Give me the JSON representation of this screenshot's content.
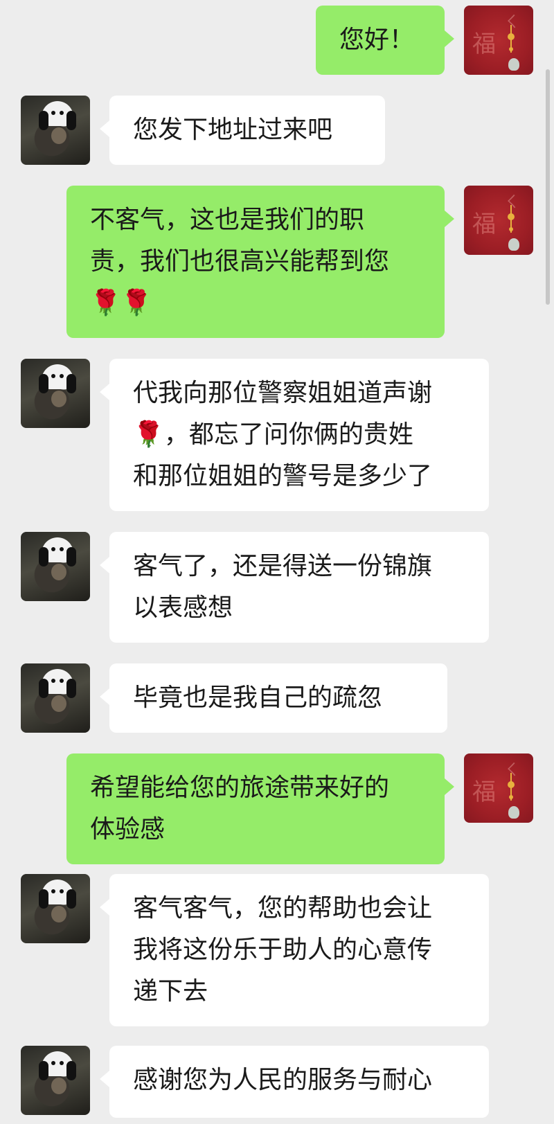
{
  "messages": [
    {
      "side": "out",
      "text": "您好！"
    },
    {
      "side": "in",
      "text": "您发下地址过来吧"
    },
    {
      "side": "out",
      "text": "不客气，这也是我们的职\n责，我们也很高兴能帮到您\n🌹🌹"
    },
    {
      "side": "in",
      "text": "代我向那位警察姐姐道声谢\n🌹，都忘了问你俩的贵姓\n和那位姐姐的警号是多少了"
    },
    {
      "side": "in",
      "text": "客气了，还是得送一份锦旗\n以表感想"
    },
    {
      "side": "in",
      "text": "毕竟也是我自己的疏忽"
    },
    {
      "side": "out",
      "text": "希望能给您的旅途带来好的\n体验感"
    },
    {
      "side": "in",
      "text": "客气客气，您的帮助也会让\n我将这份乐于助人的心意传\n递下去"
    },
    {
      "side": "in",
      "text": "感谢您为人民的服务与耐心"
    }
  ],
  "colors": {
    "background": "#ededed",
    "incoming_bubble": "#ffffff",
    "outgoing_bubble": "#95ec69",
    "text": "#1a1a1a"
  },
  "icons": {
    "incoming_avatar": "user-avatar-icon",
    "outgoing_avatar": "red-fu-avatar-icon"
  }
}
